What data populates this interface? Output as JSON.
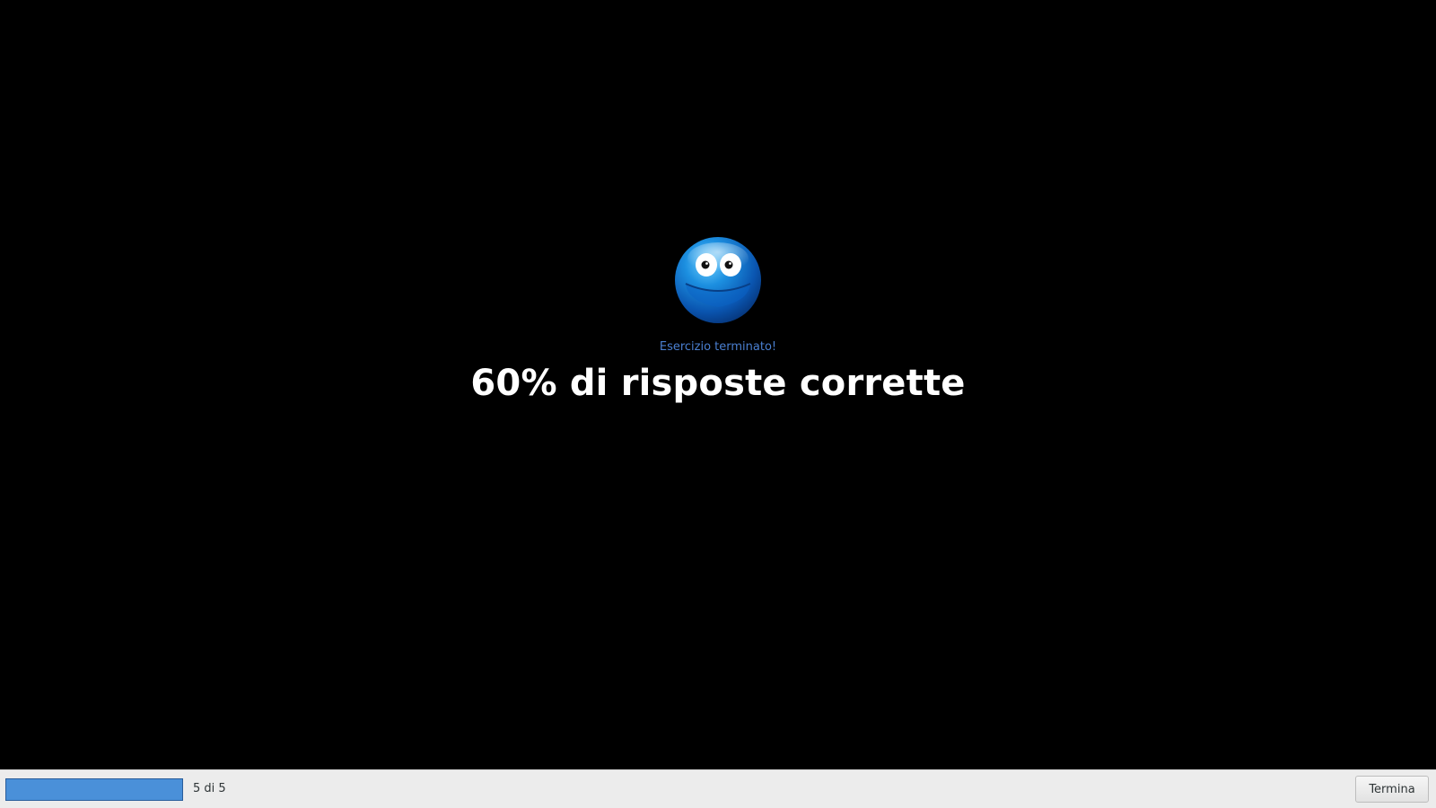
{
  "result": {
    "icon": "happy-blue-smiley-icon",
    "subtitle": "Esercizio terminato!",
    "score_text": "60% di risposte corrette"
  },
  "bottom_bar": {
    "progress": {
      "current": 5,
      "total": 5,
      "fraction": 1.0
    },
    "counter_text": "5 di 5",
    "end_button_label": "Termina"
  },
  "colors": {
    "background": "#000000",
    "subtitle": "#4a7fd0",
    "score": "#ffffff",
    "progress_fill": "#4a90d9",
    "bar_background": "#ececec"
  }
}
